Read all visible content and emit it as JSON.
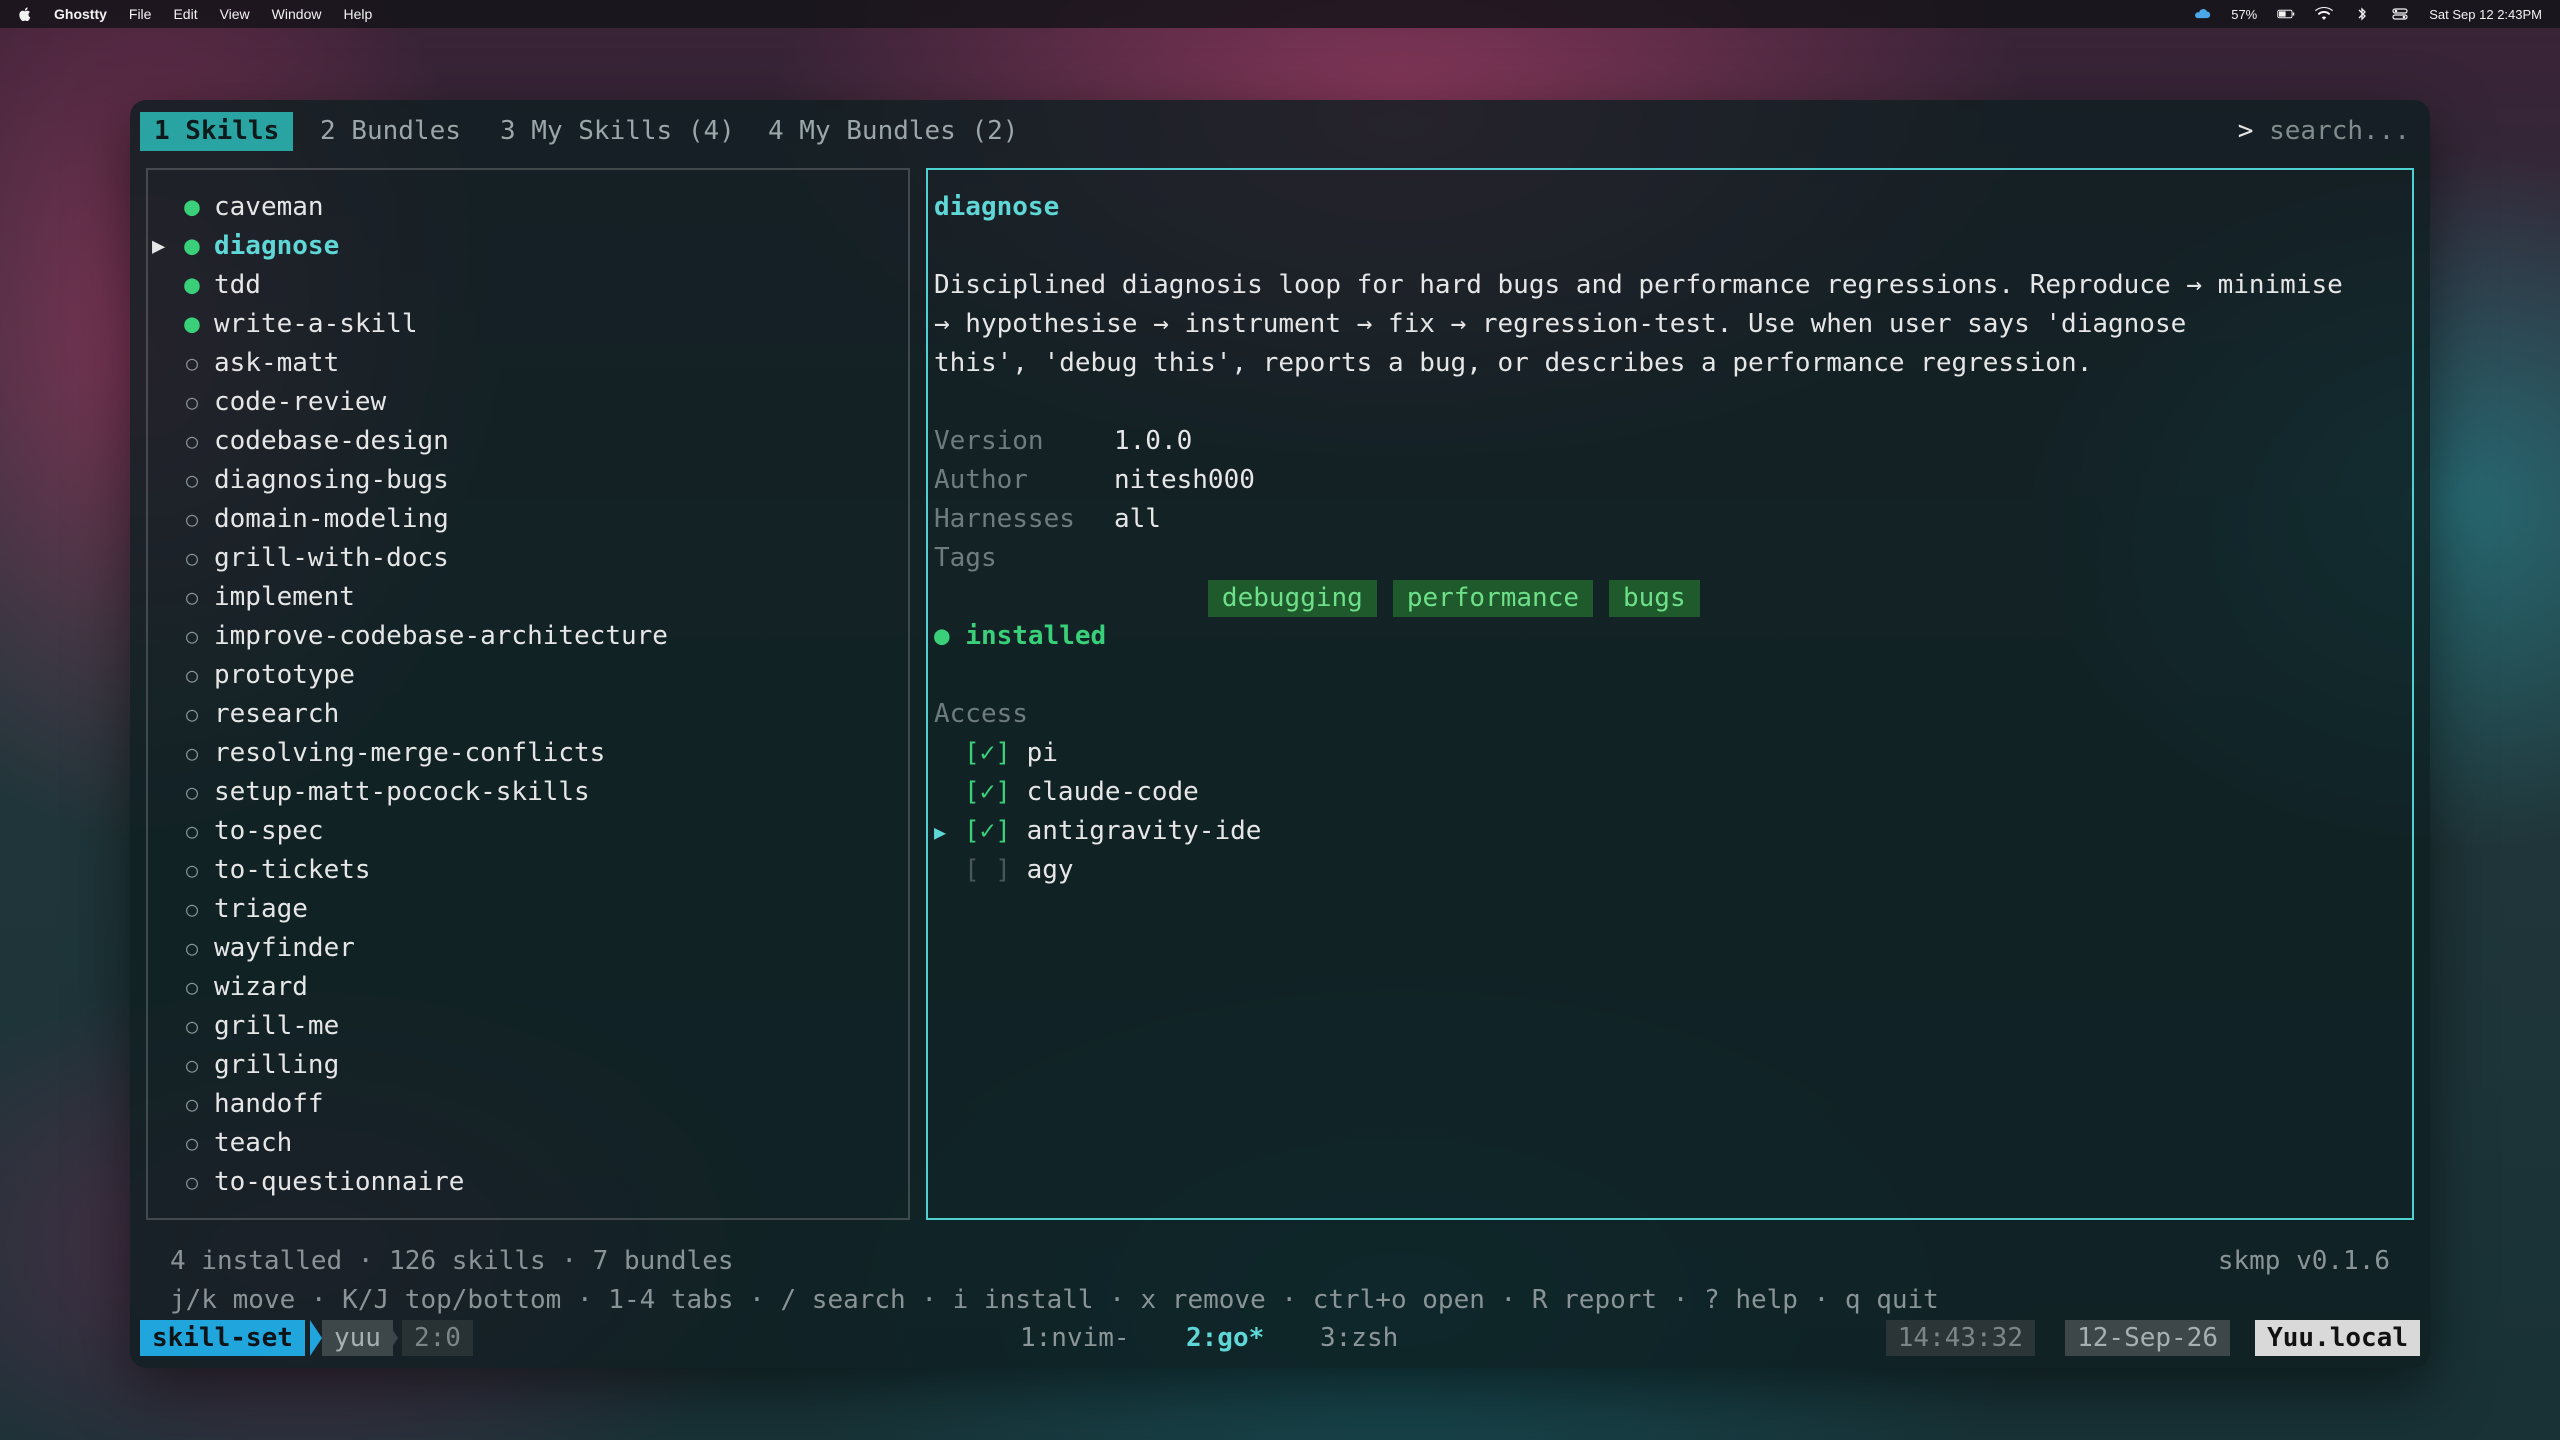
{
  "menubar": {
    "app_name": "Ghostty",
    "menus": [
      "File",
      "Edit",
      "View",
      "Window",
      "Help"
    ],
    "battery": "57%",
    "datetime": "Sat Sep 12  2:43PM"
  },
  "tabs": [
    {
      "label": "1 Skills",
      "active": true
    },
    {
      "label": "2 Bundles",
      "active": false
    },
    {
      "label": "3 My Skills (4)",
      "active": false
    },
    {
      "label": "4 My Bundles (2)",
      "active": false
    }
  ],
  "search": {
    "prompt": ">",
    "placeholder": "search..."
  },
  "skills": [
    {
      "name": "caveman",
      "installed": true
    },
    {
      "name": "diagnose",
      "installed": true,
      "selected": true
    },
    {
      "name": "tdd",
      "installed": true
    },
    {
      "name": "write-a-skill",
      "installed": true
    },
    {
      "name": "ask-matt",
      "installed": false
    },
    {
      "name": "code-review",
      "installed": false
    },
    {
      "name": "codebase-design",
      "installed": false
    },
    {
      "name": "diagnosing-bugs",
      "installed": false
    },
    {
      "name": "domain-modeling",
      "installed": false
    },
    {
      "name": "grill-with-docs",
      "installed": false
    },
    {
      "name": "implement",
      "installed": false
    },
    {
      "name": "improve-codebase-architecture",
      "installed": false
    },
    {
      "name": "prototype",
      "installed": false
    },
    {
      "name": "research",
      "installed": false
    },
    {
      "name": "resolving-merge-conflicts",
      "installed": false
    },
    {
      "name": "setup-matt-pocock-skills",
      "installed": false
    },
    {
      "name": "to-spec",
      "installed": false
    },
    {
      "name": "to-tickets",
      "installed": false
    },
    {
      "name": "triage",
      "installed": false
    },
    {
      "name": "wayfinder",
      "installed": false
    },
    {
      "name": "wizard",
      "installed": false
    },
    {
      "name": "grill-me",
      "installed": false
    },
    {
      "name": "grilling",
      "installed": false
    },
    {
      "name": "handoff",
      "installed": false
    },
    {
      "name": "teach",
      "installed": false
    },
    {
      "name": "to-questionnaire",
      "installed": false
    }
  ],
  "detail": {
    "title": "diagnose",
    "description": [
      "Disciplined diagnosis loop for hard bugs and performance regressions. Reproduce → minimise",
      "→ hypothesise → instrument → fix → regression-test. Use when user says 'diagnose",
      "this', 'debug this', reports a bug, or describes a performance regression."
    ],
    "fields": [
      {
        "label": "Version",
        "value": "1.0.0"
      },
      {
        "label": "Author",
        "value": "nitesh000"
      },
      {
        "label": "Harnesses",
        "value": "all"
      }
    ],
    "tags_label": "Tags",
    "tags": [
      "debugging",
      "performance",
      "bugs"
    ],
    "status": "installed",
    "access_label": "Access",
    "access": [
      {
        "checkbox": "[✓]",
        "name": "pi",
        "checked": true,
        "cursor": false
      },
      {
        "checkbox": "[✓]",
        "name": "claude-code",
        "checked": true,
        "cursor": false
      },
      {
        "checkbox": "[✓]",
        "name": "antigravity-ide",
        "checked": true,
        "cursor": true
      },
      {
        "checkbox": "[ ]",
        "name": "agy",
        "checked": false,
        "cursor": false
      }
    ]
  },
  "footer": {
    "summary": "4 installed · 126 skills · 7 bundles",
    "version": "skmp v0.1.6",
    "keys": "j/k move · K/J top/bottom · 1-4 tabs · / search · i install · x remove · ctrl+o open · R report · ? help · q quit"
  },
  "tmux": {
    "session": "skill-set",
    "user": "yuu",
    "pane": "2:0",
    "windows": [
      "1:nvim-",
      "2:go*",
      "3:zsh"
    ],
    "time": "14:43:32",
    "date": "12-Sep-26",
    "host": "Yuu.local"
  },
  "colors": {
    "accent": "#4fd1d1",
    "installed_green": "#3ad07a",
    "tag_bg": "#1f5a2c",
    "tmux_session": "#21a5dd"
  }
}
